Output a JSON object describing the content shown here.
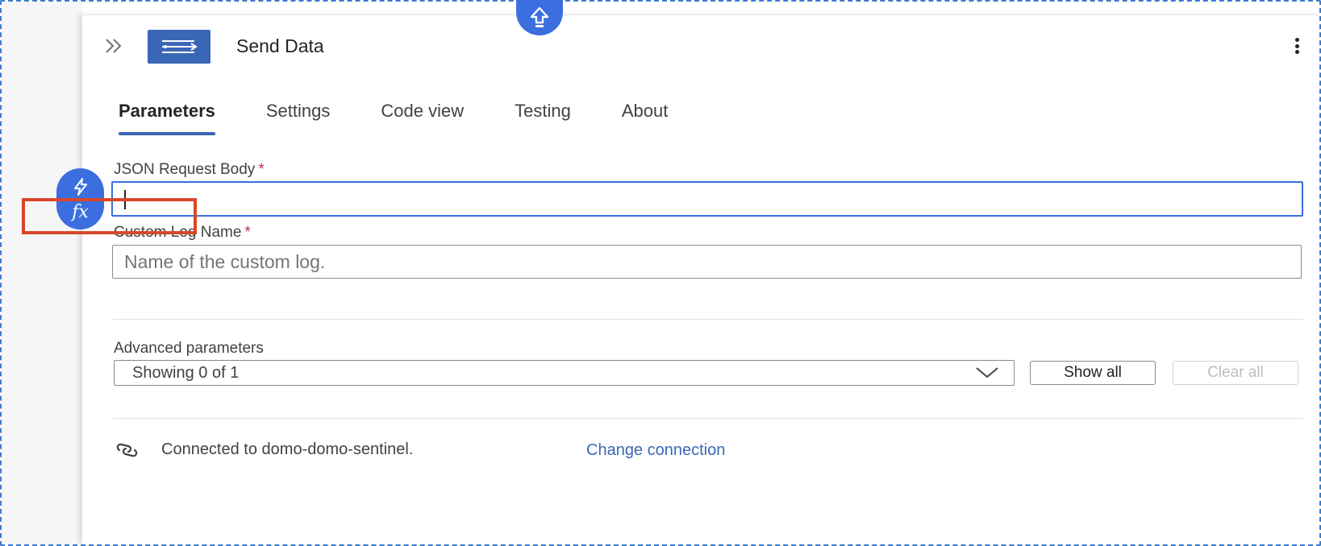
{
  "header": {
    "title": "Send Data"
  },
  "tabs": [
    {
      "label": "Parameters",
      "active": true
    },
    {
      "label": "Settings",
      "active": false
    },
    {
      "label": "Code view",
      "active": false
    },
    {
      "label": "Testing",
      "active": false
    },
    {
      "label": "About",
      "active": false
    }
  ],
  "fields": {
    "json_body": {
      "label": "JSON Request Body",
      "required": "*",
      "value": ""
    },
    "custom_log": {
      "label": "Custom Log Name",
      "required": "*",
      "placeholder": "Name of the custom log."
    }
  },
  "expression_toolbar": {
    "fx_label": "fx"
  },
  "advanced": {
    "label": "Advanced parameters",
    "selected": "Showing 0 of 1",
    "show_all": "Show all",
    "clear_all": "Clear all"
  },
  "connection": {
    "text": "Connected to domo-domo-sentinel.",
    "change_link": "Change connection"
  },
  "colors": {
    "accent": "#3b6fe0",
    "tile": "#3a67b5",
    "highlight": "#d9472b",
    "required": "#c4314b"
  },
  "icons": {
    "top": "arrow-up-icon",
    "collapse": "double-chevron-right-icon",
    "tile": "action-lines-icon",
    "more": "more-vertical-icon",
    "lightning": "lightning-icon",
    "dropdown": "chevron-down-icon",
    "connection": "link-icon"
  }
}
